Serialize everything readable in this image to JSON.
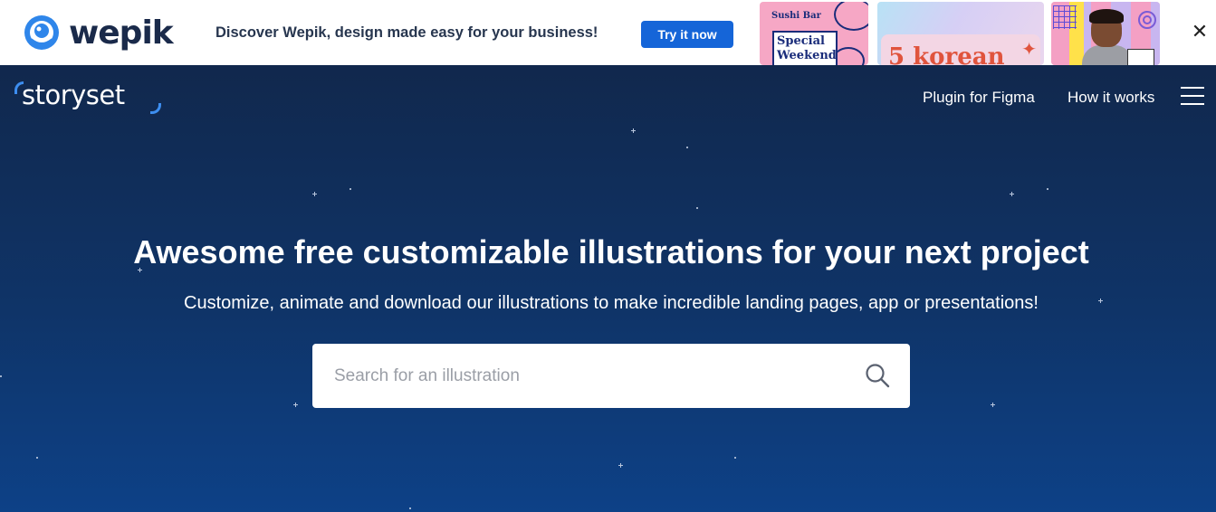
{
  "banner": {
    "brand": "wepik",
    "message": "Discover Wepik, design made easy for your business!",
    "cta_label": "Try it now",
    "close_label": "✕",
    "thumbnails": [
      {
        "header": "Sushi Bar",
        "line1": "Special",
        "line2": "Weekend"
      },
      {
        "text": "5 korean"
      },
      {
        "icon": "person-photo"
      }
    ]
  },
  "header": {
    "brand": "storyset",
    "nav": [
      {
        "label": "Plugin for Figma"
      },
      {
        "label": "How it works"
      }
    ],
    "menu_icon": "hamburger-icon"
  },
  "hero": {
    "title": "Awesome free customizable illustrations for your next project",
    "subtitle": "Customize, animate and download our illustrations to make incredible landing pages, app or presentations!",
    "search": {
      "value": "",
      "placeholder": "Search for an illustration",
      "icon": "search-icon"
    }
  },
  "colors": {
    "banner_bg": "#ffffff",
    "cta": "#1565d8",
    "hero_top": "#11284d",
    "hero_bottom": "#0d4187",
    "accent": "#3d8ef0"
  }
}
